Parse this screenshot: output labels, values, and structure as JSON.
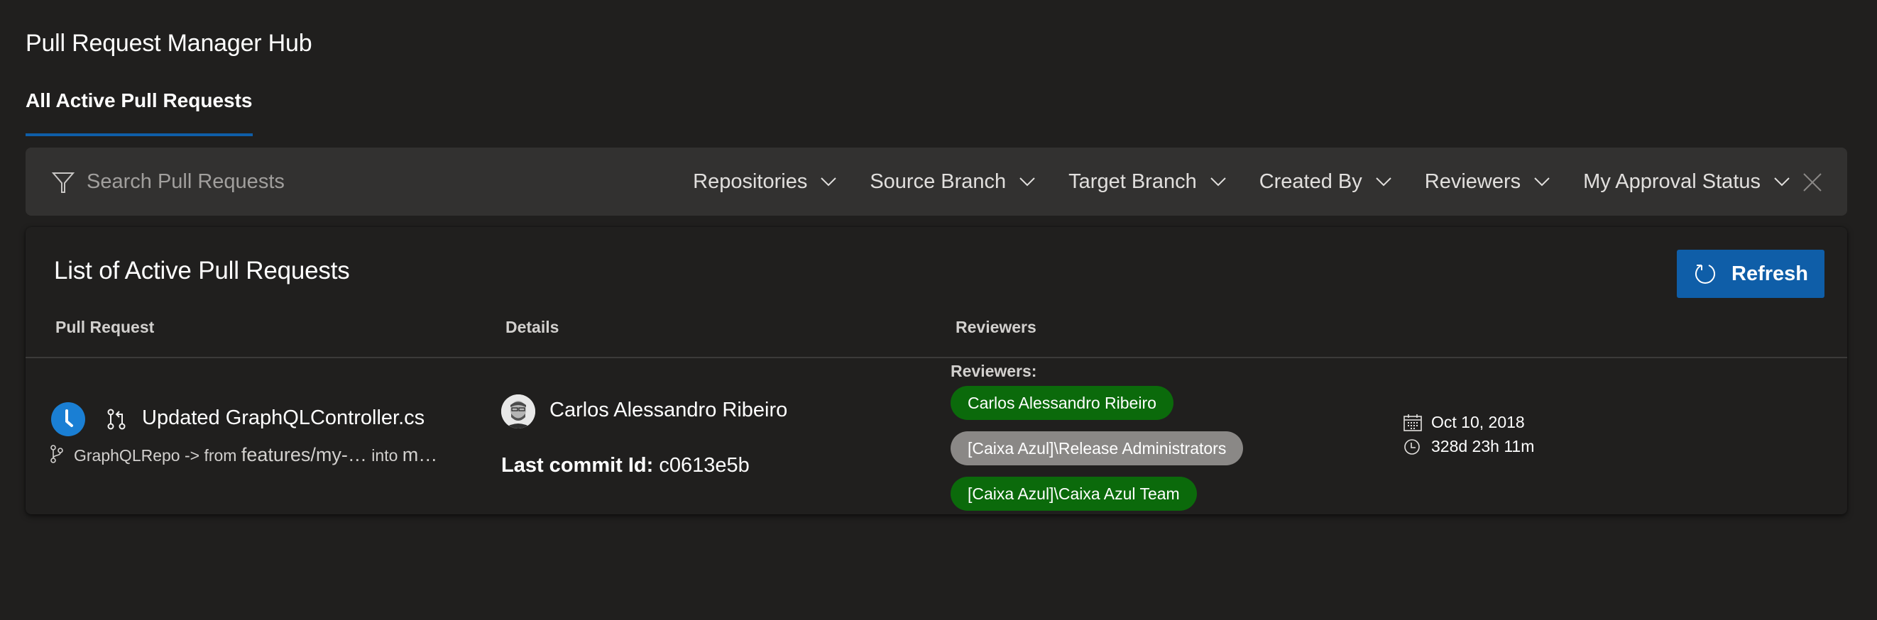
{
  "header": {
    "title": "Pull Request Manager Hub",
    "active_tab": "All Active Pull Requests"
  },
  "filter_bar": {
    "search_placeholder": "Search Pull Requests",
    "search_value": "",
    "filter_icon": "funnel-icon",
    "dropdowns": [
      {
        "label": "Repositories"
      },
      {
        "label": "Source Branch"
      },
      {
        "label": "Target Branch"
      },
      {
        "label": "Created By"
      },
      {
        "label": "Reviewers"
      },
      {
        "label": "My Approval Status"
      }
    ],
    "clear_icon": "close-icon"
  },
  "list": {
    "title": "List of Active Pull Requests",
    "refresh_label": "Refresh",
    "columns": [
      "Pull Request",
      "Details",
      "Reviewers"
    ],
    "rows": [
      {
        "status_icon": "clock-icon",
        "title": "Updated GraphQLController.cs",
        "repo": "GraphQLRepo",
        "arrow_from": "-> from",
        "source_branch": "features/my-…",
        "into": "into",
        "target_branch": "m…",
        "author": "Carlos Alessandro Ribeiro",
        "last_commit_label": "Last commit Id:",
        "last_commit_id": "c0613e5b",
        "reviewers_label": "Reviewers:",
        "reviewers": [
          {
            "name": "Carlos Alessandro Ribeiro",
            "status": "approved",
            "color": "#0b6a0b"
          },
          {
            "name": "[Caixa Azul]\\Release Administrators",
            "status": "no-vote",
            "color": "#8a8886"
          },
          {
            "name": "[Caixa Azul]\\Caixa Azul Team",
            "status": "approved",
            "color": "#0b6a0b"
          }
        ],
        "created_date": "Oct 10, 2018",
        "elapsed": "328d 23h 11m"
      }
    ]
  },
  "colors": {
    "accent": "#0f5ea8",
    "status_blue": "#1a7fd4",
    "approved_green": "#0b6a0b",
    "neutral_gray": "#8a8886",
    "background": "#201f1e",
    "filter_bar_bg": "#323130"
  }
}
